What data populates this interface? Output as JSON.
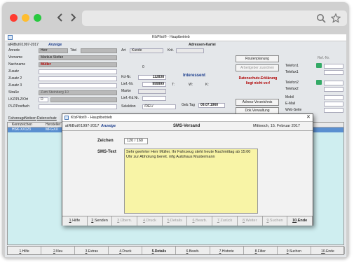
{
  "browser": {
    "dot_colors": [
      "#ff3b30",
      "#ffbd2e",
      "#27c93f"
    ],
    "back_glyph": "‹",
    "forward_glyph": "›"
  },
  "app": {
    "title": "KfzPilot® - Hauptbetrieb",
    "copyright": "atRiBut©1997-2017",
    "mode": "Anzeige",
    "section_title": "Adressen-Kartei",
    "labels": {
      "anrede": "Anrede",
      "titel": "Titel",
      "vorname": "Vorname",
      "nachname": "Nachname",
      "zusatz": "Zusatz",
      "zusatz2": "Zusatz 2",
      "zusatz3": "Zusatz 3",
      "strasse": "Straße",
      "lkz": "LKZ/PLZ/Ort",
      "plzpost": "PLZ/Postfach",
      "art": "Art",
      "krit": "Krit.",
      "kdnr": "Kd-Nr.",
      "liefnr": "Lief.-Nr.",
      "marke": "Marke",
      "liefkdnr": "Lief.-Kd.Nr.",
      "selektion": "Selektion",
      "gebtag": "Geb.Tag",
      "t": "T:",
      "w": "W:",
      "k": "K:",
      "telefon1": "Telefon1",
      "telefax1": "Telefax1",
      "telefon2": "Telefon2",
      "telefax2": "Telefax2",
      "mobil": "Mobil",
      "email": "E-Mail",
      "webseite": "Web-Seite",
      "refnr": "Ref.-Nr."
    },
    "values": {
      "anrede": "Herr",
      "vorname": "Markus Stefan",
      "nachname": "Müller",
      "art": "Kunde",
      "lkz": "D",
      "kdnr": "112838",
      "liefnr": "999999",
      "selektion": "/DEL/",
      "gebtag": "09.07.1960",
      "zero": "0",
      "strasse": "Zum Steinberg 10"
    },
    "interessent_title": "Interessent",
    "datenschutz": "Datenschutz-Erklärung liegt nicht vor!",
    "buttons": {
      "routenplanung": "Routenplanung",
      "arbeitgeber": "Arbeitgeber zuordnen",
      "adress_verzeichnis": "Adress-Verzeichnis",
      "dok_verwaltung": "Dok.Verwaltung"
    },
    "tabs": [
      "Fahrzeuge",
      "Notizen",
      "Datenschutz"
    ],
    "grid_headers": [
      "Kennzeichen",
      "Hersteller"
    ],
    "grid_row": [
      "HSK-XX123",
      "MFGXX"
    ],
    "bottom_buttons": [
      {
        "key": "1",
        "label": "Hilfe"
      },
      {
        "key": "2",
        "label": "Neu"
      },
      {
        "key": "3",
        "label": "Extras"
      },
      {
        "key": "4",
        "label": "Druck"
      },
      {
        "key": "5",
        "label": "Details"
      },
      {
        "key": "6",
        "label": "Bearb."
      },
      {
        "key": "7",
        "label": "Historie"
      },
      {
        "key": "8",
        "label": "Filter"
      },
      {
        "key": "9",
        "label": "Suchen"
      },
      {
        "key": "10",
        "label": "Ende"
      }
    ]
  },
  "sms_dialog": {
    "window_title": "KfzPilot® - Hauptbetrieb",
    "copyright": "atRiBut©1997-2017",
    "mode": "Anzeige",
    "title": "SMS-Versand",
    "date": "Mittwoch, 15. Februar 2017",
    "zeichen_label": "Zeichen",
    "zeichen_value": "120 / 160",
    "text_label": "SMS-Text",
    "text": "Sehr geehrter Herr Müller, Ihr Fahrzeug steht heute Nachmittag ab 15:00 Uhr zur Abholung bereit. mfg Autohaus Mustermann",
    "close_glyph": "✕",
    "buttons": [
      {
        "key": "1",
        "label": "Hilfe",
        "enabled": true
      },
      {
        "key": "2",
        "label": "Senden",
        "enabled": true
      },
      {
        "key": "3",
        "label": "Übern.",
        "enabled": false
      },
      {
        "key": "4",
        "label": "Druck",
        "enabled": false
      },
      {
        "key": "5",
        "label": "Details",
        "enabled": false
      },
      {
        "key": "6",
        "label": "Bearb.",
        "enabled": false
      },
      {
        "key": "7",
        "label": "Zurück",
        "enabled": false
      },
      {
        "key": "8",
        "label": "Weiter",
        "enabled": false
      },
      {
        "key": "9",
        "label": "Suchen",
        "enabled": false
      },
      {
        "key": "10",
        "label": "Ende",
        "enabled": true
      }
    ]
  }
}
